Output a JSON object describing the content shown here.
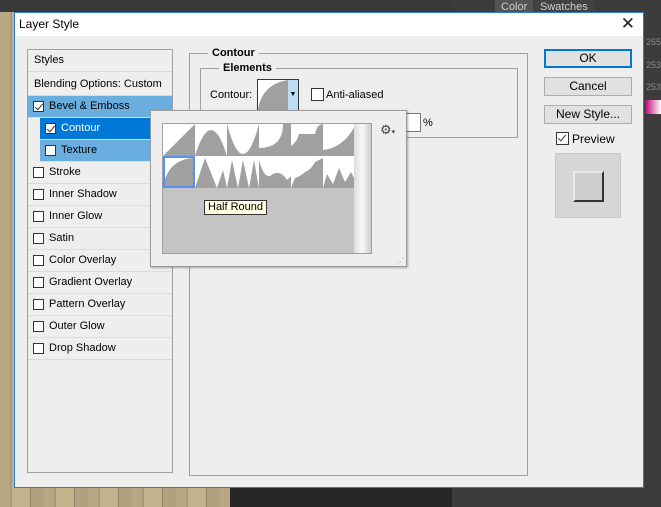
{
  "background": {
    "panel_tabs": [
      "Color",
      "Swatches"
    ],
    "values": [
      "255",
      "253",
      "253"
    ]
  },
  "dialog": {
    "title": "Layer Style"
  },
  "styles_list": {
    "header": "Styles",
    "blending": "Blending Options: Custom",
    "items": [
      {
        "label": "Bevel & Emboss",
        "checked": true
      },
      {
        "label": "Contour",
        "checked": true
      },
      {
        "label": "Texture",
        "checked": false
      },
      {
        "label": "Stroke",
        "checked": false
      },
      {
        "label": "Inner Shadow",
        "checked": false
      },
      {
        "label": "Inner Glow",
        "checked": false
      },
      {
        "label": "Satin",
        "checked": false
      },
      {
        "label": "Color Overlay",
        "checked": false
      },
      {
        "label": "Gradient Overlay",
        "checked": false
      },
      {
        "label": "Pattern Overlay",
        "checked": false
      },
      {
        "label": "Outer Glow",
        "checked": false
      },
      {
        "label": "Drop Shadow",
        "checked": false
      }
    ]
  },
  "contour_panel": {
    "group_title": "Contour",
    "elements_title": "Elements",
    "contour_label": "Contour:",
    "anti_aliased_label": "Anti-aliased",
    "anti_aliased": false,
    "range_unit": "%"
  },
  "contour_picker": {
    "tooltip": "Half Round",
    "selected_index": 6,
    "gear_icon": "gear-icon"
  },
  "buttons": {
    "ok": "OK",
    "cancel": "Cancel",
    "new_style": "New Style..."
  },
  "preview": {
    "label": "Preview",
    "checked": true
  },
  "colors": {
    "accent": "#0078d7",
    "selected_row": "#0078d7",
    "parent_row": "#6aaee0"
  }
}
